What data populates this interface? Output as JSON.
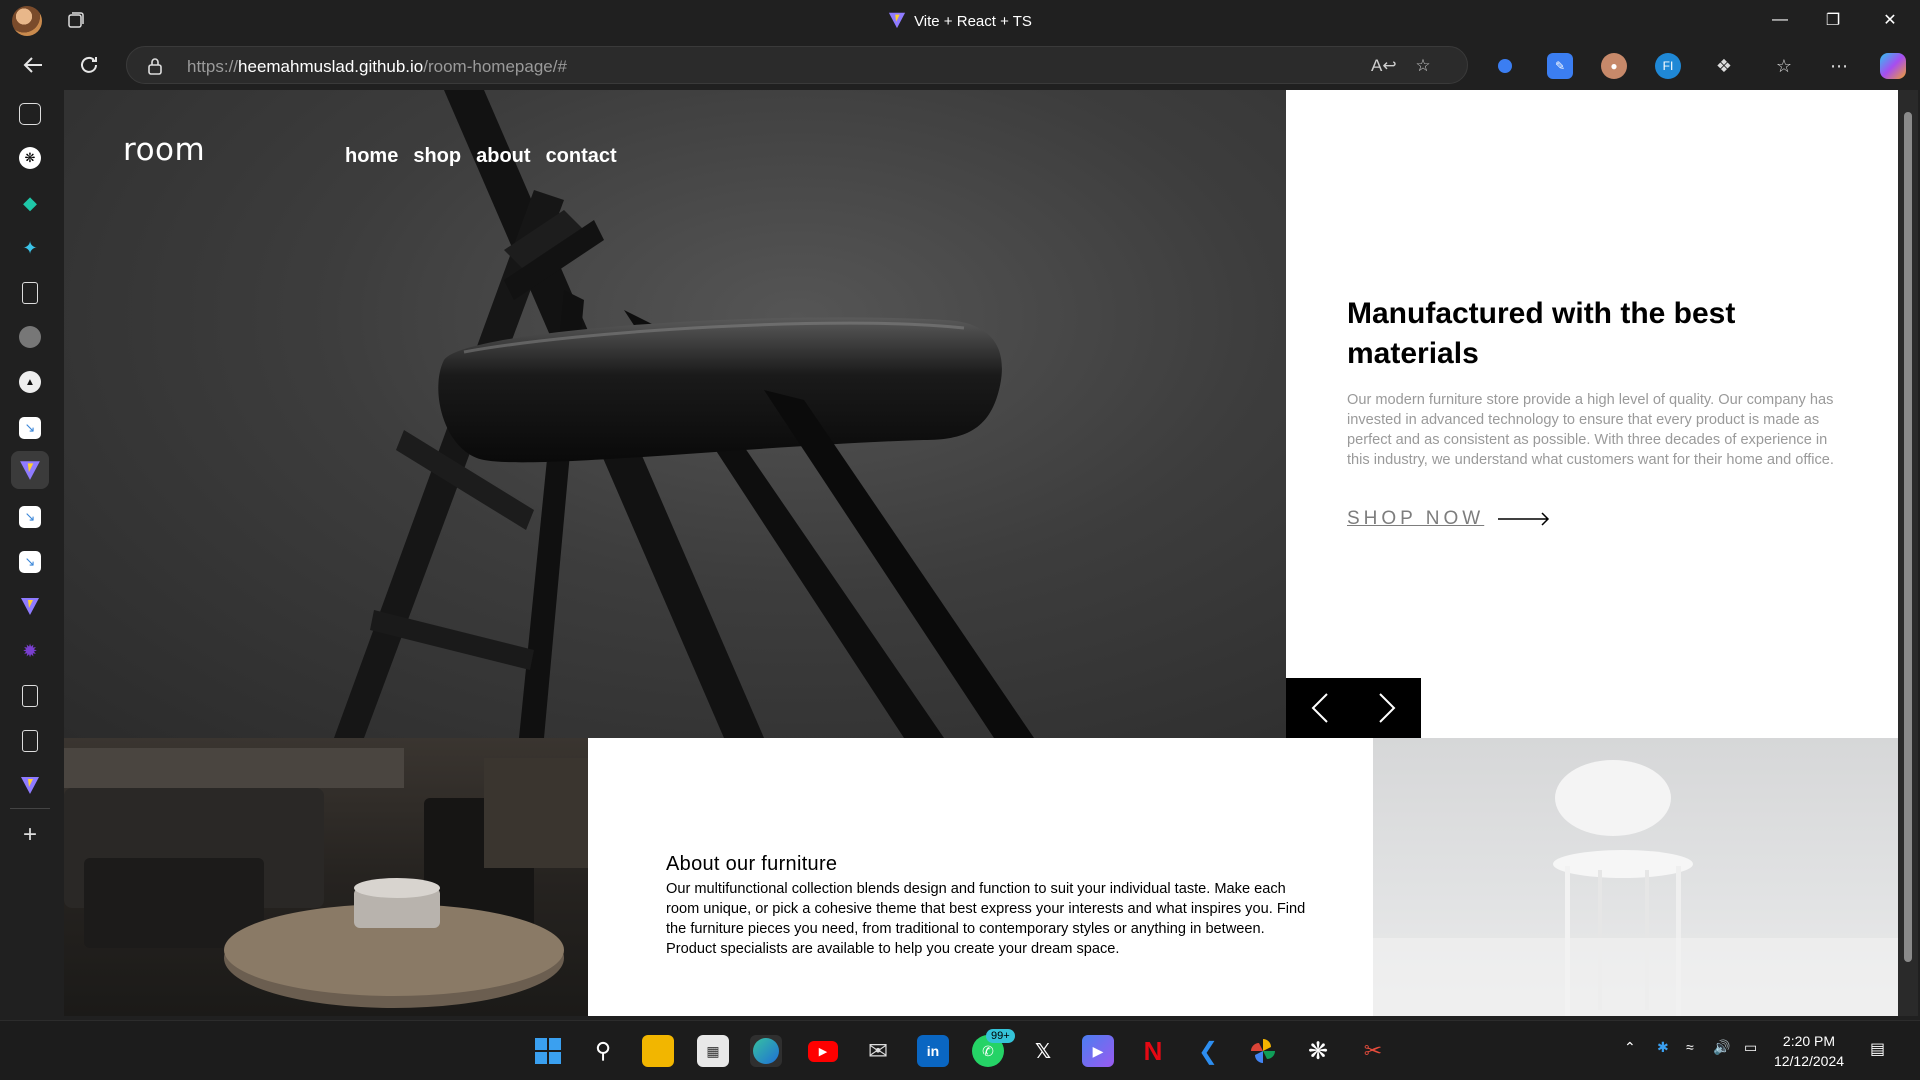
{
  "browser": {
    "tab_title": "Vite + React + TS",
    "url_prefix": "https://",
    "url_host": "heemahmuslad.github.io",
    "url_path": "/room-homepage/#"
  },
  "site": {
    "logo": "room",
    "nav": [
      "home",
      "shop",
      "about",
      "contact"
    ],
    "hero_title": "Manufactured with the best materials",
    "hero_text": "Our modern furniture store provide a high level of quality. Our company has invested in advanced technology to ensure that every product is made as perfect and as consistent as possible. With three decades of experience in this industry, we understand what customers want for their home and office.",
    "cta": "SHOP NOW",
    "about_title": "About our furniture",
    "about_text": "Our multifunctional collection blends design and function to suit your individual taste. Make each room unique, or pick a cohesive theme that best express your interests and what inspires you. Find the furniture pieces you need, from traditional to contemporary styles or anything in between. Product specialists are available to help you create your dream space."
  },
  "taskbar": {
    "whatsapp_badge": "99+",
    "time": "2:20 PM",
    "date": "12/12/2024"
  },
  "colors": {
    "hero_bg": "#3d3d3d",
    "body_text_muted": "#9a9a9a",
    "slider_bg": "#000000"
  }
}
